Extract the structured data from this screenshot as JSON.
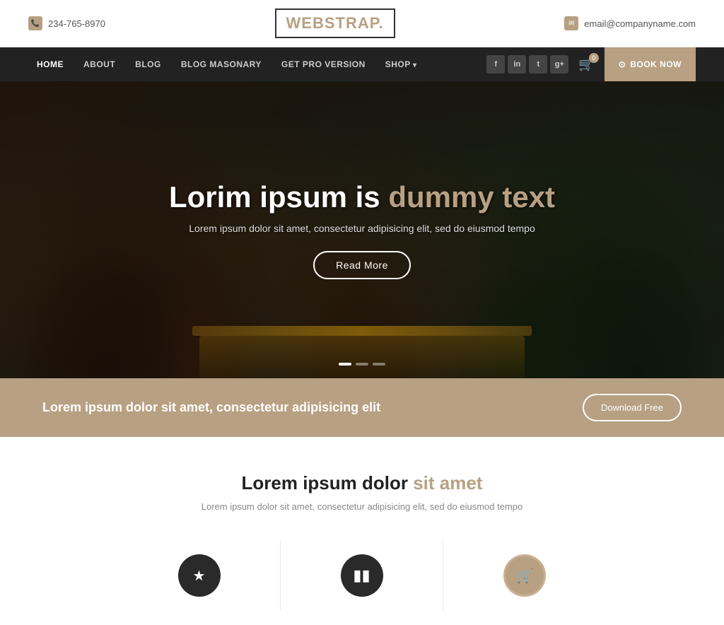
{
  "topbar": {
    "phone": "234-765-8970",
    "email": "email@companyname.com"
  },
  "logo": {
    "text_part1": "WEB",
    "text_part2": "STRAP.",
    "tagline": ""
  },
  "nav": {
    "links": [
      {
        "label": "HOME",
        "active": true,
        "has_arrow": false
      },
      {
        "label": "ABOUT",
        "active": false,
        "has_arrow": false
      },
      {
        "label": "BLOG",
        "active": false,
        "has_arrow": false
      },
      {
        "label": "BLOG MASONARY",
        "active": false,
        "has_arrow": false
      },
      {
        "label": "GET PRO VERSION",
        "active": false,
        "has_arrow": false
      },
      {
        "label": "SHOP",
        "active": false,
        "has_arrow": true
      }
    ],
    "social": [
      {
        "icon": "f",
        "name": "facebook"
      },
      {
        "icon": "in",
        "name": "linkedin"
      },
      {
        "icon": "t",
        "name": "twitter"
      },
      {
        "icon": "g+",
        "name": "googleplus"
      }
    ],
    "cart_count": "0",
    "book_now": "Book Now"
  },
  "hero": {
    "title_part1": "Lorim ipsum is ",
    "title_highlight": "dummy text",
    "subtitle": "Lorem ipsum dolor sit amet, consectetur adipisicing elit, sed do eiusmod tempo",
    "cta_label": "Read More",
    "dots": [
      1,
      2,
      3
    ]
  },
  "download_banner": {
    "text": "Lorem ipsum dolor sit amet, consectetur adipisicing elit",
    "button_label": "Download Free"
  },
  "features": {
    "title_part1": "Lorem ipsum dolor ",
    "title_highlight": "sit amet",
    "subtitle": "Lorem ipsum dolor sit amet, consectetur adipisicing elit, sed do eiusmod tempo",
    "items": [
      {
        "icon": "★",
        "style": "dark"
      },
      {
        "icon": "⊞",
        "style": "dark"
      },
      {
        "icon": "🛒",
        "style": "gold"
      }
    ]
  }
}
